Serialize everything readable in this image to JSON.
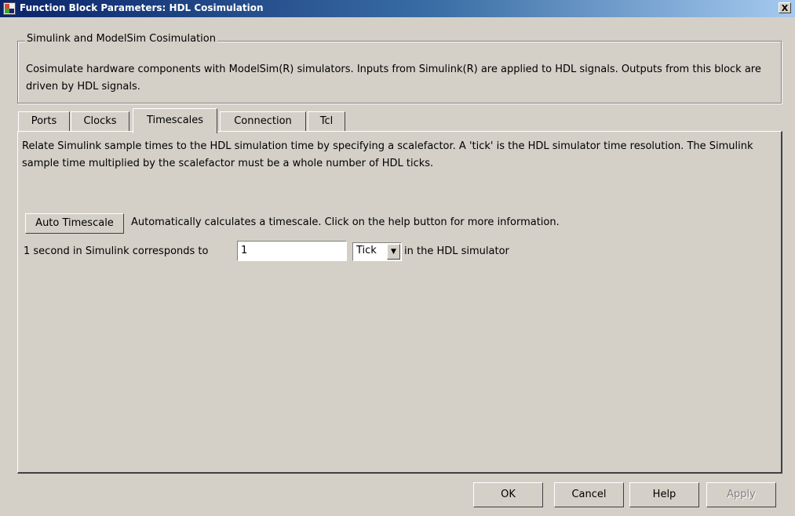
{
  "window": {
    "title": "Function Block Parameters: HDL Cosimulation",
    "close_label": "X"
  },
  "group": {
    "title": "Simulink and ModelSim Cosimulation",
    "description": "Cosimulate hardware components with ModelSim(R) simulators. Inputs from Simulink(R) are applied to HDL signals. Outputs from this block are driven by HDL signals."
  },
  "tabs": [
    {
      "label": "Ports",
      "active": false
    },
    {
      "label": "Clocks",
      "active": false
    },
    {
      "label": "Timescales",
      "active": true
    },
    {
      "label": "Connection",
      "active": false
    },
    {
      "label": "Tcl",
      "active": false
    }
  ],
  "timescales": {
    "description": "Relate Simulink sample times to the HDL simulation time by specifying a scalefactor. A 'tick' is the HDL simulator time resolution. The Simulink sample time multiplied by the scalefactor must be a whole number of HDL ticks.",
    "auto_button": "Auto Timescale",
    "auto_text": "Automatically calculates a timescale. Click on the help button for more information.",
    "corr_label": "1 second in Simulink corresponds to",
    "value": "1",
    "unit": "Tick",
    "after_label": "in the HDL simulator"
  },
  "buttons": {
    "ok": "OK",
    "cancel": "Cancel",
    "help": "Help",
    "apply": "Apply"
  }
}
